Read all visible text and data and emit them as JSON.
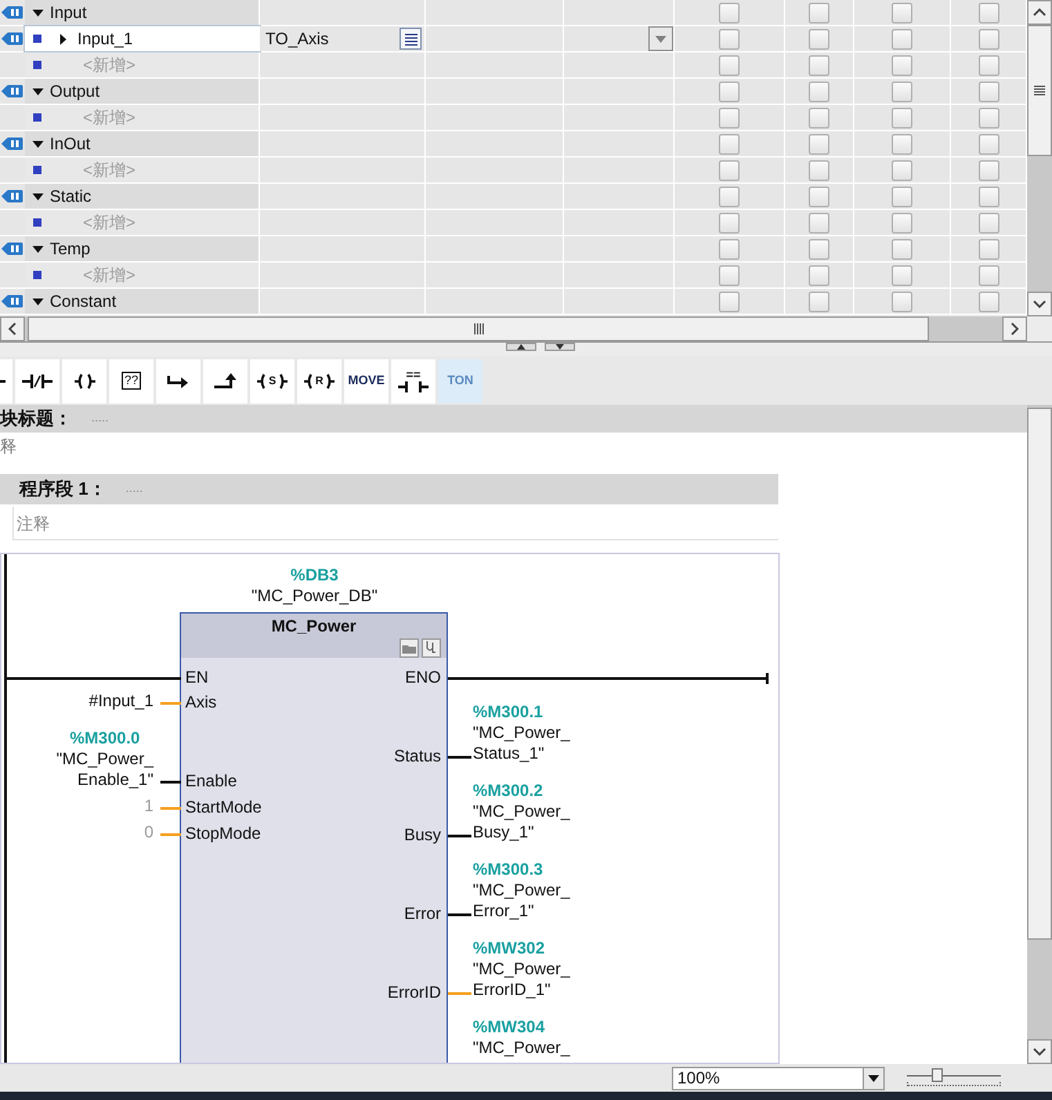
{
  "interface_table": {
    "rows": [
      {
        "kind": "section",
        "name": "Input",
        "expanded": true,
        "checks": [
          false,
          false,
          false,
          false
        ],
        "children": [
          {
            "kind": "variable",
            "name": "Input_1",
            "data_type": "TO_Axis",
            "selected": true,
            "expanded": false,
            "checks": [
              false,
              false,
              false,
              false
            ]
          },
          {
            "kind": "add",
            "name": "<新增>",
            "checks": [
              false,
              false,
              false,
              false
            ]
          }
        ]
      },
      {
        "kind": "section",
        "name": "Output",
        "expanded": true,
        "checks": [
          false,
          false,
          false,
          false
        ],
        "children": [
          {
            "kind": "add",
            "name": "<新增>",
            "checks": [
              false,
              false,
              false,
              false
            ]
          }
        ]
      },
      {
        "kind": "section",
        "name": "InOut",
        "expanded": true,
        "checks": [
          false,
          false,
          false,
          false
        ],
        "children": [
          {
            "kind": "add",
            "name": "<新增>",
            "checks": [
              false,
              false,
              false,
              false
            ]
          }
        ]
      },
      {
        "kind": "section",
        "name": "Static",
        "expanded": true,
        "checks": [
          false,
          false,
          false,
          false
        ],
        "children": [
          {
            "kind": "add",
            "name": "<新增>",
            "checks": [
              false,
              false,
              false,
              false
            ]
          }
        ]
      },
      {
        "kind": "section",
        "name": "Temp",
        "expanded": true,
        "checks": [
          false,
          false,
          false,
          false
        ],
        "children": [
          {
            "kind": "add",
            "name": "<新增>",
            "checks": [
              false,
              false,
              false,
              false
            ]
          }
        ]
      },
      {
        "kind": "section",
        "name": "Constant",
        "expanded": true,
        "checks": [
          false,
          false,
          false,
          false
        ]
      }
    ]
  },
  "toolbar": {
    "buttons": [
      {
        "kind": "contact_no",
        "selected": false
      },
      {
        "kind": "contact_nc",
        "selected": false
      },
      {
        "kind": "coil",
        "selected": false
      },
      {
        "kind": "empty_box",
        "label": "??",
        "selected": false
      },
      {
        "kind": "open_branch",
        "selected": false
      },
      {
        "kind": "close_branch",
        "selected": false
      },
      {
        "kind": "coil",
        "label": "S",
        "selected": false
      },
      {
        "kind": "coil",
        "label": "R",
        "selected": false
      },
      {
        "kind": "text",
        "label": "MOVE",
        "selected": false
      },
      {
        "kind": "compare",
        "label": "==",
        "selected": false
      },
      {
        "kind": "text",
        "label": "TON",
        "selected": true
      }
    ]
  },
  "block_title": {
    "label": "块标题：",
    "value": "....."
  },
  "block_comment": "释",
  "network": {
    "title": "程序段 1：",
    "value": ".....",
    "comment_placeholder": "注释",
    "block": {
      "instance_address": "%DB3",
      "instance_name": "\"MC_Power_DB\"",
      "type": "MC_Power",
      "inputs": [
        {
          "name": "EN",
          "kind": "power"
        },
        {
          "name": "Axis",
          "kind": "value",
          "operand_lines": [
            "#Input_1"
          ]
        },
        {
          "name": "Enable",
          "kind": "bool",
          "address": "%M300.0",
          "operand_lines": [
            "\"MC_Power_",
            "Enable_1\""
          ]
        },
        {
          "name": "StartMode",
          "kind": "constant",
          "operand_lines": [
            "1"
          ]
        },
        {
          "name": "StopMode",
          "kind": "constant",
          "operand_lines": [
            "0"
          ]
        }
      ],
      "outputs": [
        {
          "name": "ENO",
          "kind": "power"
        },
        {
          "name": "Status",
          "kind": "bool",
          "address": "%M300.1",
          "operand_lines": [
            "\"MC_Power_",
            "Status_1\""
          ]
        },
        {
          "name": "Busy",
          "kind": "bool",
          "address": "%M300.2",
          "operand_lines": [
            "\"MC_Power_",
            "Busy_1\""
          ]
        },
        {
          "name": "Error",
          "kind": "bool",
          "address": "%M300.3",
          "operand_lines": [
            "\"MC_Power_",
            "Error_1\""
          ]
        },
        {
          "name": "ErrorID",
          "kind": "value",
          "address": "%MW302",
          "operand_lines": [
            "\"MC_Power_",
            "ErrorID_1\""
          ]
        },
        {
          "kind": "value",
          "address": "%MW304",
          "operand_lines": [
            "\"MC_Power_"
          ]
        }
      ]
    }
  },
  "zoom": {
    "value": "100%",
    "level": 0.3
  }
}
